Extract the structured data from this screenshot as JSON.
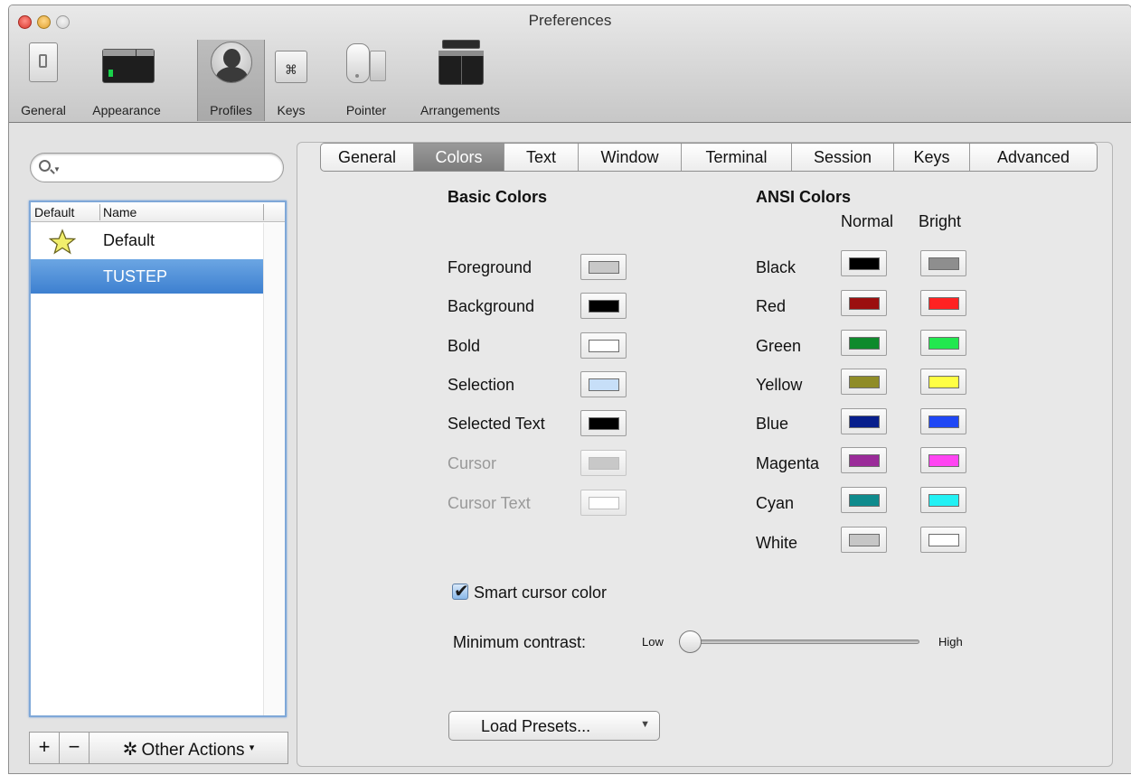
{
  "window": {
    "title": "Preferences"
  },
  "toolbar": {
    "items": [
      {
        "label": "General"
      },
      {
        "label": "Appearance"
      },
      {
        "label": "Profiles"
      },
      {
        "label": "Keys"
      },
      {
        "label": "Pointer"
      },
      {
        "label": "Arrangements"
      }
    ],
    "keys_glyph": "⌘"
  },
  "search": {
    "placeholder": ""
  },
  "profiles_table": {
    "columns": [
      "Default",
      "Name"
    ],
    "rows": [
      {
        "name": "Default",
        "is_default": true
      },
      {
        "name": "TUSTEP",
        "selected": true
      }
    ]
  },
  "list_buttons": {
    "add": "+",
    "remove": "−",
    "other": "Other Actions",
    "other_arrow": "▾",
    "gear": "✲"
  },
  "tabs": [
    "General",
    "Colors",
    "Text",
    "Window",
    "Terminal",
    "Session",
    "Keys",
    "Advanced"
  ],
  "active_tab": "Colors",
  "basic_colors": {
    "heading": "Basic Colors",
    "items": [
      {
        "label": "Foreground",
        "color": "#c8c8c8",
        "enabled": true
      },
      {
        "label": "Background",
        "color": "#000000",
        "enabled": true
      },
      {
        "label": "Bold",
        "color": "#ffffff",
        "enabled": true
      },
      {
        "label": "Selection",
        "color": "#c7dff8",
        "enabled": true
      },
      {
        "label": "Selected Text",
        "color": "#000000",
        "enabled": true
      },
      {
        "label": "Cursor",
        "color": "#c8c8c8",
        "enabled": false
      },
      {
        "label": "Cursor Text",
        "color": "#ffffff",
        "enabled": false
      }
    ]
  },
  "ansi_colors": {
    "heading": "ANSI Colors",
    "normal_header": "Normal",
    "bright_header": "Bright",
    "items": [
      {
        "label": "Black",
        "normal": "#000000",
        "bright": "#8e8e8e"
      },
      {
        "label": "Red",
        "normal": "#9b0f0f",
        "bright": "#ff2222"
      },
      {
        "label": "Green",
        "normal": "#0e8a2c",
        "bright": "#22e84f"
      },
      {
        "label": "Yellow",
        "normal": "#8f8c27",
        "bright": "#ffff44"
      },
      {
        "label": "Blue",
        "normal": "#071e8c",
        "bright": "#1f47f5"
      },
      {
        "label": "Magenta",
        "normal": "#9a2b99",
        "bright": "#ff44f2"
      },
      {
        "label": "Cyan",
        "normal": "#0f8b8d",
        "bright": "#22f1f4"
      },
      {
        "label": "White",
        "normal": "#c6c6c6",
        "bright": "#ffffff"
      }
    ]
  },
  "smart_cursor": {
    "label": "Smart cursor color",
    "checked": true
  },
  "min_contrast": {
    "label": "Minimum contrast:",
    "low": "Low",
    "high": "High",
    "value": 0
  },
  "load_presets": {
    "label": "Load Presets..."
  },
  "accent_colors": {
    "selection": "#3d80d0",
    "active_tab": "#8a8a8a"
  }
}
